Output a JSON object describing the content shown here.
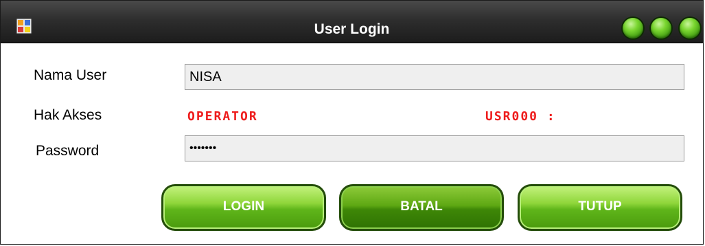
{
  "window": {
    "title": "User Login"
  },
  "form": {
    "username_label": "Nama User",
    "username_value": "NISA",
    "access_label": "Hak Akses",
    "access_value": "OPERATOR",
    "user_id_value": "USR000 :",
    "password_label": "Password",
    "password_value": "•••••••"
  },
  "buttons": {
    "login": "LOGIN",
    "cancel": "BATAL",
    "close": "TUTUP"
  },
  "colors": {
    "titlebar": "#2e2e2e",
    "accent_green": "#5fb51a",
    "lcd_red": "#ee1c1c"
  },
  "icons": {
    "app": "form-app-icon",
    "window_controls": [
      "minimize-icon",
      "maximize-icon",
      "close-icon"
    ]
  }
}
